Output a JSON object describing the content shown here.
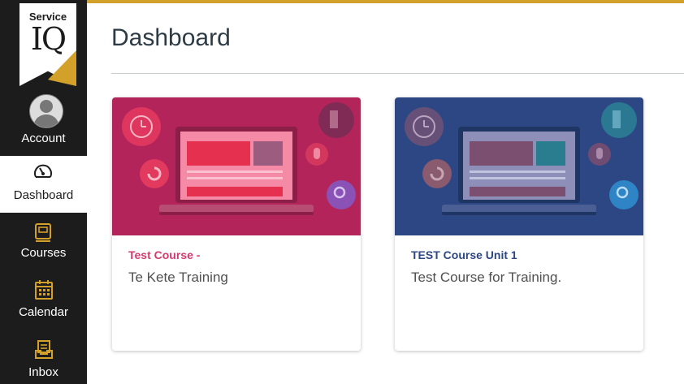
{
  "brand": {
    "line1": "Service",
    "line2": "IQ",
    "accent": "#d3a12a"
  },
  "nav": {
    "account": {
      "label": "Account",
      "icon": "avatar"
    },
    "dashboard": {
      "label": "Dashboard",
      "icon": "dashboard-gauge-icon"
    },
    "courses": {
      "label": "Courses",
      "icon": "book-icon"
    },
    "calendar": {
      "label": "Calendar",
      "icon": "calendar-icon"
    },
    "inbox": {
      "label": "Inbox",
      "icon": "inbox-icon"
    }
  },
  "page": {
    "title": "Dashboard"
  },
  "cards": [
    {
      "title": "Test Course -",
      "subtitle": "Te Kete Training",
      "color": "#b2245a"
    },
    {
      "title": "TEST Course Unit 1",
      "subtitle": "Test Course for Training.",
      "color": "#2c4783"
    }
  ]
}
